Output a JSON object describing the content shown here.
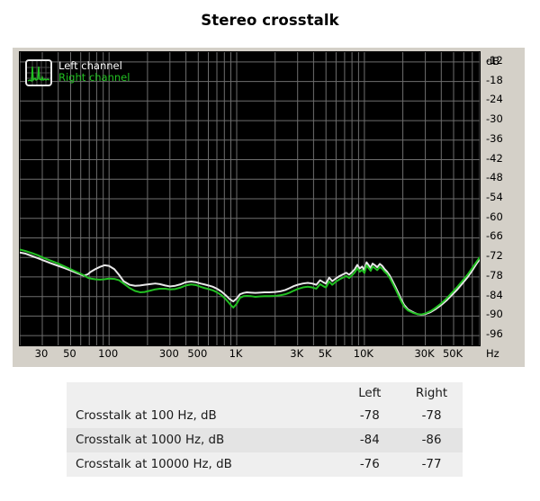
{
  "title": "Stereo crosstalk",
  "legend": {
    "icon": "spectrum-icon",
    "left_label": "Left channel",
    "right_label": "Right channel",
    "left_color": "#ffffff",
    "right_color": "#22c022"
  },
  "table": {
    "headers": [
      "",
      "Left",
      "Right"
    ],
    "rows": [
      {
        "label": "Crosstalk at 100 Hz, dB",
        "left": "-78",
        "right": "-78"
      },
      {
        "label": "Crosstalk at 1000 Hz, dB",
        "left": "-84",
        "right": "-86"
      },
      {
        "label": "Crosstalk at 10000 Hz, dB",
        "left": "-76",
        "right": "-77"
      }
    ]
  },
  "chart_data": {
    "type": "line",
    "title": "Stereo crosstalk",
    "xlabel": "Hz",
    "ylabel": "dB",
    "xscale": "log",
    "xlim": [
      20,
      80000
    ],
    "ylim": [
      -99,
      -9
    ],
    "grid": true,
    "legend_position": "top-left",
    "background": "#000000",
    "gridline_color": "#6e6e6e",
    "x_ticks": [
      {
        "value": 30,
        "label": "30"
      },
      {
        "value": 50,
        "label": "50"
      },
      {
        "value": 100,
        "label": "100"
      },
      {
        "value": 300,
        "label": "300"
      },
      {
        "value": 500,
        "label": "500"
      },
      {
        "value": 1000,
        "label": "1K"
      },
      {
        "value": 3000,
        "label": "3K"
      },
      {
        "value": 5000,
        "label": "5K"
      },
      {
        "value": 10000,
        "label": "10K"
      },
      {
        "value": 30000,
        "label": "30K"
      },
      {
        "value": 50000,
        "label": "50K"
      }
    ],
    "y_ticks": [
      -12,
      -18,
      -24,
      -30,
      -36,
      -42,
      -48,
      -54,
      -60,
      -66,
      -72,
      -78,
      -84,
      -90,
      -96
    ],
    "y_unit_label": "dB",
    "series": [
      {
        "name": "Left channel",
        "color": "#e8e8e8",
        "points": [
          [
            20,
            -70.5
          ],
          [
            22,
            -70.8
          ],
          [
            25,
            -71.6
          ],
          [
            28,
            -72.3
          ],
          [
            31,
            -73.0
          ],
          [
            35,
            -73.8
          ],
          [
            40,
            -74.6
          ],
          [
            45,
            -75.3
          ],
          [
            50,
            -76.0
          ],
          [
            56,
            -76.8
          ],
          [
            63,
            -77.6
          ],
          [
            68,
            -77.2
          ],
          [
            72,
            -76.4
          ],
          [
            78,
            -75.6
          ],
          [
            85,
            -74.9
          ],
          [
            92,
            -74.4
          ],
          [
            100,
            -74.6
          ],
          [
            110,
            -75.6
          ],
          [
            120,
            -77.4
          ],
          [
            130,
            -79.3
          ],
          [
            145,
            -80.4
          ],
          [
            160,
            -80.7
          ],
          [
            175,
            -80.6
          ],
          [
            190,
            -80.4
          ],
          [
            210,
            -80.2
          ],
          [
            230,
            -80.0
          ],
          [
            250,
            -80.2
          ],
          [
            275,
            -80.6
          ],
          [
            300,
            -80.9
          ],
          [
            330,
            -80.7
          ],
          [
            360,
            -80.3
          ],
          [
            400,
            -79.6
          ],
          [
            440,
            -79.4
          ],
          [
            480,
            -79.6
          ],
          [
            520,
            -80.0
          ],
          [
            560,
            -80.3
          ],
          [
            600,
            -80.6
          ],
          [
            650,
            -81.0
          ],
          [
            700,
            -81.6
          ],
          [
            760,
            -82.5
          ],
          [
            820,
            -83.6
          ],
          [
            880,
            -84.8
          ],
          [
            940,
            -85.5
          ],
          [
            1000,
            -84.6
          ],
          [
            1060,
            -83.3
          ],
          [
            1130,
            -82.9
          ],
          [
            1200,
            -82.7
          ],
          [
            1300,
            -82.8
          ],
          [
            1400,
            -82.9
          ],
          [
            1500,
            -82.8
          ],
          [
            1650,
            -82.7
          ],
          [
            1800,
            -82.7
          ],
          [
            2000,
            -82.6
          ],
          [
            2200,
            -82.4
          ],
          [
            2400,
            -82.0
          ],
          [
            2600,
            -81.4
          ],
          [
            2800,
            -80.8
          ],
          [
            3000,
            -80.4
          ],
          [
            3300,
            -80.0
          ],
          [
            3600,
            -79.8
          ],
          [
            3900,
            -80.0
          ],
          [
            4200,
            -80.4
          ],
          [
            4500,
            -79.0
          ],
          [
            4800,
            -79.7
          ],
          [
            5000,
            -80.0
          ],
          [
            5300,
            -78.2
          ],
          [
            5600,
            -79.3
          ],
          [
            6000,
            -78.4
          ],
          [
            6400,
            -77.7
          ],
          [
            6800,
            -77.2
          ],
          [
            7200,
            -76.7
          ],
          [
            7600,
            -77.3
          ],
          [
            8000,
            -76.5
          ],
          [
            8400,
            -75.6
          ],
          [
            8800,
            -74.3
          ],
          [
            9200,
            -75.4
          ],
          [
            9600,
            -74.8
          ],
          [
            10000,
            -75.9
          ],
          [
            10400,
            -73.5
          ],
          [
            10800,
            -74.4
          ],
          [
            11200,
            -75.2
          ],
          [
            11600,
            -73.9
          ],
          [
            12000,
            -74.3
          ],
          [
            12600,
            -75.0
          ],
          [
            13200,
            -74.0
          ],
          [
            13800,
            -74.6
          ],
          [
            14400,
            -75.6
          ],
          [
            15000,
            -76.3
          ],
          [
            15800,
            -77.6
          ],
          [
            16600,
            -79.2
          ],
          [
            17500,
            -81.0
          ],
          [
            18500,
            -83.0
          ],
          [
            19500,
            -85.0
          ],
          [
            20500,
            -86.6
          ],
          [
            22000,
            -88.0
          ],
          [
            24000,
            -88.8
          ],
          [
            26000,
            -89.4
          ],
          [
            28000,
            -89.6
          ],
          [
            30000,
            -89.4
          ],
          [
            33000,
            -88.8
          ],
          [
            36000,
            -87.9
          ],
          [
            40000,
            -86.6
          ],
          [
            44000,
            -85.2
          ],
          [
            48000,
            -83.7
          ],
          [
            53000,
            -82.0
          ],
          [
            58000,
            -80.2
          ],
          [
            64000,
            -78.2
          ],
          [
            70000,
            -76.0
          ],
          [
            76000,
            -73.8
          ],
          [
            80000,
            -72.6
          ]
        ]
      },
      {
        "name": "Right channel",
        "color": "#22c022",
        "points": [
          [
            20,
            -69.6
          ],
          [
            22,
            -70.0
          ],
          [
            25,
            -70.7
          ],
          [
            28,
            -71.4
          ],
          [
            31,
            -72.2
          ],
          [
            35,
            -73.0
          ],
          [
            40,
            -73.9
          ],
          [
            45,
            -74.8
          ],
          [
            50,
            -75.6
          ],
          [
            56,
            -76.5
          ],
          [
            63,
            -77.4
          ],
          [
            68,
            -78.2
          ],
          [
            72,
            -78.5
          ],
          [
            78,
            -78.7
          ],
          [
            85,
            -78.8
          ],
          [
            92,
            -78.7
          ],
          [
            100,
            -78.5
          ],
          [
            110,
            -78.6
          ],
          [
            120,
            -79.0
          ],
          [
            130,
            -80.0
          ],
          [
            145,
            -81.4
          ],
          [
            160,
            -82.3
          ],
          [
            175,
            -82.7
          ],
          [
            190,
            -82.6
          ],
          [
            210,
            -82.2
          ],
          [
            230,
            -81.8
          ],
          [
            250,
            -81.6
          ],
          [
            275,
            -81.6
          ],
          [
            300,
            -81.8
          ],
          [
            330,
            -81.7
          ],
          [
            360,
            -81.3
          ],
          [
            400,
            -80.6
          ],
          [
            440,
            -80.3
          ],
          [
            480,
            -80.5
          ],
          [
            520,
            -81.0
          ],
          [
            560,
            -81.4
          ],
          [
            600,
            -81.7
          ],
          [
            650,
            -82.1
          ],
          [
            700,
            -82.7
          ],
          [
            760,
            -83.6
          ],
          [
            820,
            -84.8
          ],
          [
            880,
            -86.2
          ],
          [
            940,
            -87.4
          ],
          [
            1000,
            -86.2
          ],
          [
            1060,
            -84.4
          ],
          [
            1130,
            -83.9
          ],
          [
            1200,
            -83.8
          ],
          [
            1300,
            -83.9
          ],
          [
            1400,
            -84.1
          ],
          [
            1500,
            -84.0
          ],
          [
            1650,
            -83.9
          ],
          [
            1800,
            -83.9
          ],
          [
            2000,
            -83.8
          ],
          [
            2200,
            -83.6
          ],
          [
            2400,
            -83.3
          ],
          [
            2600,
            -82.8
          ],
          [
            2800,
            -82.2
          ],
          [
            3000,
            -81.7
          ],
          [
            3300,
            -81.2
          ],
          [
            3600,
            -81.0
          ],
          [
            3900,
            -81.2
          ],
          [
            4200,
            -81.6
          ],
          [
            4500,
            -80.2
          ],
          [
            4800,
            -80.9
          ],
          [
            5000,
            -81.2
          ],
          [
            5300,
            -79.4
          ],
          [
            5600,
            -80.4
          ],
          [
            6000,
            -79.4
          ],
          [
            6400,
            -78.7
          ],
          [
            6800,
            -78.2
          ],
          [
            7200,
            -77.7
          ],
          [
            7600,
            -78.3
          ],
          [
            8000,
            -77.5
          ],
          [
            8400,
            -76.6
          ],
          [
            8800,
            -75.3
          ],
          [
            9200,
            -76.4
          ],
          [
            9600,
            -75.8
          ],
          [
            10000,
            -76.8
          ],
          [
            10400,
            -74.4
          ],
          [
            10800,
            -75.3
          ],
          [
            11200,
            -76.1
          ],
          [
            11600,
            -74.8
          ],
          [
            12000,
            -75.2
          ],
          [
            12600,
            -75.9
          ],
          [
            13200,
            -74.9
          ],
          [
            13800,
            -75.5
          ],
          [
            14400,
            -76.4
          ],
          [
            15000,
            -77.0
          ],
          [
            15800,
            -78.3
          ],
          [
            16600,
            -79.9
          ],
          [
            17500,
            -81.7
          ],
          [
            18500,
            -83.7
          ],
          [
            19500,
            -85.6
          ],
          [
            20500,
            -87.1
          ],
          [
            22000,
            -88.3
          ],
          [
            24000,
            -89.0
          ],
          [
            26000,
            -89.4
          ],
          [
            28000,
            -89.5
          ],
          [
            30000,
            -89.2
          ],
          [
            33000,
            -88.5
          ],
          [
            36000,
            -87.5
          ],
          [
            40000,
            -86.1
          ],
          [
            44000,
            -84.6
          ],
          [
            48000,
            -83.0
          ],
          [
            53000,
            -81.2
          ],
          [
            58000,
            -79.4
          ],
          [
            64000,
            -77.4
          ],
          [
            70000,
            -75.2
          ],
          [
            76000,
            -73.2
          ],
          [
            80000,
            -72.0
          ]
        ]
      }
    ]
  }
}
